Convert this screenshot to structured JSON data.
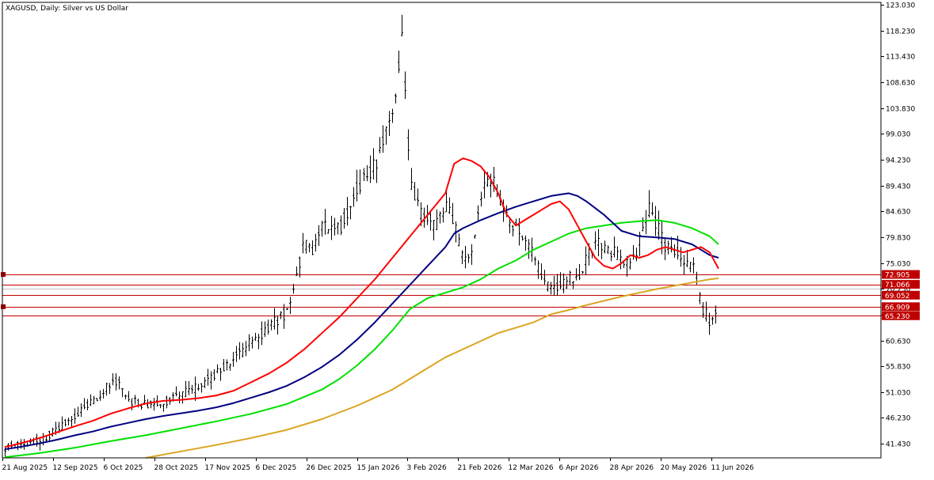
{
  "chart_data": {
    "type": "ohlc",
    "title": "XAGUSD, Daily:  Silver vs US Dollar",
    "y_ticks": [
      "123.030",
      "118.230",
      "113.430",
      "108.630",
      "103.830",
      "99.030",
      "94.230",
      "89.430",
      "84.630",
      "79.830",
      "75.030",
      "70.230",
      "65.430",
      "60.630",
      "55.830",
      "51.030",
      "46.230",
      "41.430"
    ],
    "x_ticks": [
      "21 Aug 2025",
      "12 Sep 2025",
      "6 Oct 2025",
      "28 Oct 2025",
      "17 Nov 2025",
      "6 Dec 2025",
      "26 Dec 2025",
      "15 Jan 2026",
      "3 Feb 2026",
      "21 Feb 2026",
      "12 Mar 2026",
      "6 Apr 2026",
      "28 Apr 2026",
      "20 May 2026",
      "11 Jun 2026"
    ],
    "ylim": [
      38.8,
      123.5
    ],
    "grid": false,
    "price_lines": [
      {
        "value": 72.905,
        "label": "72.905",
        "color": "#c00000",
        "tag": true
      },
      {
        "value": 71.066,
        "label": "71.066",
        "color": "#c00000",
        "tag": false
      },
      {
        "value": 70.23,
        "label": "",
        "color": "#c0c0c0",
        "tag": false
      },
      {
        "value": 69.052,
        "label": "69.052",
        "color": "#c00000",
        "tag": false
      },
      {
        "value": 66.909,
        "label": "66.909",
        "color": "#c00000",
        "tag": true
      },
      {
        "value": 65.23,
        "label": "65.230",
        "color": "#c00000",
        "tag": false
      }
    ],
    "colors": {
      "bars": "#000000",
      "ma_red": "#ff0000",
      "ma_navy": "#000080",
      "ma_green": "#00e000",
      "ma_gold": "#daa520",
      "tag": "#c00000"
    },
    "ma_red": [
      [
        0,
        40.8
      ],
      [
        10,
        41.6
      ],
      [
        20,
        42.5
      ],
      [
        30,
        43.6
      ],
      [
        40,
        44.7
      ],
      [
        50,
        45.7
      ],
      [
        60,
        47.0
      ],
      [
        70,
        48.0
      ],
      [
        80,
        48.9
      ],
      [
        90,
        49.4
      ],
      [
        100,
        49.6
      ],
      [
        110,
        49.9
      ],
      [
        120,
        50.4
      ],
      [
        130,
        51.3
      ],
      [
        140,
        52.9
      ],
      [
        150,
        54.5
      ],
      [
        160,
        56.5
      ],
      [
        170,
        59.0
      ],
      [
        180,
        62.0
      ],
      [
        190,
        65.0
      ],
      [
        200,
        68.5
      ],
      [
        210,
        72.0
      ],
      [
        220,
        76.0
      ],
      [
        230,
        80.0
      ],
      [
        240,
        84.0
      ],
      [
        250,
        88.0
      ],
      [
        255,
        93.5
      ],
      [
        260,
        94.5
      ],
      [
        265,
        94.0
      ],
      [
        270,
        93.0
      ],
      [
        275,
        91.0
      ],
      [
        280,
        88.0
      ],
      [
        285,
        84.0
      ],
      [
        290,
        82.0
      ],
      [
        295,
        83.0
      ],
      [
        300,
        84.0
      ],
      [
        305,
        85.0
      ],
      [
        310,
        86.0
      ],
      [
        315,
        86.5
      ],
      [
        320,
        85.0
      ],
      [
        325,
        82.0
      ],
      [
        330,
        79.0
      ],
      [
        335,
        76.0
      ],
      [
        340,
        74.5
      ],
      [
        345,
        74.0
      ],
      [
        350,
        75.0
      ],
      [
        355,
        76.5
      ],
      [
        360,
        76.0
      ],
      [
        365,
        76.5
      ],
      [
        370,
        77.5
      ],
      [
        375,
        78.0
      ],
      [
        380,
        77.5
      ],
      [
        385,
        77.0
      ],
      [
        390,
        77.5
      ],
      [
        395,
        78.0
      ],
      [
        400,
        77.0
      ],
      [
        405,
        74.0
      ]
    ],
    "ma_navy": [
      [
        0,
        40.4
      ],
      [
        10,
        40.9
      ],
      [
        20,
        41.5
      ],
      [
        30,
        42.2
      ],
      [
        40,
        43.0
      ],
      [
        50,
        43.7
      ],
      [
        60,
        44.6
      ],
      [
        70,
        45.3
      ],
      [
        80,
        46.0
      ],
      [
        90,
        46.6
      ],
      [
        100,
        47.1
      ],
      [
        110,
        47.6
      ],
      [
        120,
        48.2
      ],
      [
        130,
        49.0
      ],
      [
        140,
        50.0
      ],
      [
        150,
        51.0
      ],
      [
        160,
        52.2
      ],
      [
        170,
        53.8
      ],
      [
        180,
        55.7
      ],
      [
        190,
        58.0
      ],
      [
        200,
        60.8
      ],
      [
        210,
        64.0
      ],
      [
        220,
        67.5
      ],
      [
        230,
        71.0
      ],
      [
        240,
        74.5
      ],
      [
        250,
        78.0
      ],
      [
        255,
        80.5
      ],
      [
        260,
        81.5
      ],
      [
        270,
        83.0
      ],
      [
        280,
        84.3
      ],
      [
        290,
        85.5
      ],
      [
        300,
        86.5
      ],
      [
        310,
        87.5
      ],
      [
        320,
        88.0
      ],
      [
        325,
        87.5
      ],
      [
        330,
        86.5
      ],
      [
        340,
        84.0
      ],
      [
        350,
        81.0
      ],
      [
        360,
        80.0
      ],
      [
        370,
        79.8
      ],
      [
        380,
        79.5
      ],
      [
        390,
        78.5
      ],
      [
        395,
        77.5
      ],
      [
        400,
        76.5
      ],
      [
        405,
        76.0
      ]
    ],
    "ma_green": [
      [
        0,
        38.9
      ],
      [
        20,
        39.7
      ],
      [
        40,
        40.7
      ],
      [
        60,
        41.9
      ],
      [
        80,
        43.0
      ],
      [
        100,
        44.3
      ],
      [
        120,
        45.6
      ],
      [
        140,
        47.0
      ],
      [
        160,
        48.8
      ],
      [
        180,
        51.5
      ],
      [
        190,
        53.5
      ],
      [
        200,
        56.0
      ],
      [
        210,
        59.0
      ],
      [
        220,
        62.5
      ],
      [
        230,
        66.5
      ],
      [
        240,
        68.5
      ],
      [
        250,
        69.5
      ],
      [
        260,
        70.5
      ],
      [
        270,
        72.0
      ],
      [
        280,
        74.0
      ],
      [
        290,
        75.5
      ],
      [
        300,
        77.5
      ],
      [
        310,
        79.0
      ],
      [
        320,
        80.5
      ],
      [
        330,
        81.5
      ],
      [
        340,
        82.0
      ],
      [
        350,
        82.5
      ],
      [
        360,
        82.8
      ],
      [
        370,
        83.0
      ],
      [
        380,
        82.5
      ],
      [
        390,
        81.5
      ],
      [
        400,
        80.0
      ],
      [
        405,
        78.5
      ]
    ],
    "ma_gold": [
      [
        80,
        38.8
      ],
      [
        100,
        40.0
      ],
      [
        120,
        41.2
      ],
      [
        140,
        42.5
      ],
      [
        160,
        44.0
      ],
      [
        180,
        46.0
      ],
      [
        200,
        48.5
      ],
      [
        210,
        50.0
      ],
      [
        220,
        51.5
      ],
      [
        230,
        53.5
      ],
      [
        240,
        55.5
      ],
      [
        250,
        57.5
      ],
      [
        260,
        59.0
      ],
      [
        270,
        60.5
      ],
      [
        280,
        62.0
      ],
      [
        290,
        63.0
      ],
      [
        300,
        64.0
      ],
      [
        310,
        65.5
      ],
      [
        320,
        66.3
      ],
      [
        330,
        67.2
      ],
      [
        340,
        68.0
      ],
      [
        350,
        68.8
      ],
      [
        360,
        69.5
      ],
      [
        370,
        70.2
      ],
      [
        380,
        70.8
      ],
      [
        390,
        71.4
      ],
      [
        400,
        72.0
      ],
      [
        405,
        72.2
      ]
    ],
    "bar_anchors": [
      [
        0,
        40.7
      ],
      [
        20,
        42.0
      ],
      [
        30,
        44.0
      ],
      [
        40,
        46.5
      ],
      [
        50,
        49.5
      ],
      [
        60,
        52.5
      ],
      [
        65,
        53.0
      ],
      [
        70,
        49.5
      ],
      [
        80,
        48.5
      ],
      [
        90,
        49.0
      ],
      [
        100,
        50.5
      ],
      [
        110,
        52.0
      ],
      [
        120,
        54.5
      ],
      [
        130,
        57.0
      ],
      [
        140,
        60.5
      ],
      [
        150,
        63.0
      ],
      [
        160,
        66.0
      ],
      [
        165,
        72.0
      ],
      [
        170,
        79.0
      ],
      [
        175,
        77.0
      ],
      [
        180,
        82.0
      ],
      [
        190,
        81.0
      ],
      [
        200,
        89.0
      ],
      [
        205,
        92.0
      ],
      [
        210,
        93.0
      ],
      [
        215,
        99.0
      ],
      [
        220,
        104.0
      ],
      [
        225,
        117.0
      ],
      [
        230,
        90.0
      ],
      [
        235,
        85.0
      ],
      [
        240,
        83.0
      ],
      [
        245,
        82.0
      ],
      [
        250,
        86.0
      ],
      [
        255,
        82.0
      ],
      [
        260,
        75.0
      ],
      [
        265,
        78.0
      ],
      [
        270,
        87.0
      ],
      [
        275,
        91.0
      ],
      [
        280,
        88.0
      ],
      [
        285,
        83.0
      ],
      [
        290,
        82.0
      ],
      [
        295,
        80.0
      ],
      [
        300,
        76.0
      ],
      [
        305,
        72.0
      ],
      [
        310,
        70.0
      ],
      [
        315,
        70.5
      ],
      [
        320,
        72.0
      ],
      [
        325,
        73.0
      ],
      [
        330,
        76.0
      ],
      [
        335,
        79.0
      ],
      [
        340,
        78.0
      ],
      [
        345,
        77.0
      ],
      [
        350,
        75.0
      ],
      [
        355,
        74.0
      ],
      [
        360,
        79.0
      ],
      [
        365,
        85.0
      ],
      [
        370,
        82.0
      ],
      [
        375,
        78.0
      ],
      [
        380,
        77.0
      ],
      [
        385,
        76.0
      ],
      [
        390,
        75.0
      ],
      [
        395,
        67.0
      ],
      [
        400,
        64.0
      ],
      [
        405,
        68.0
      ]
    ]
  }
}
